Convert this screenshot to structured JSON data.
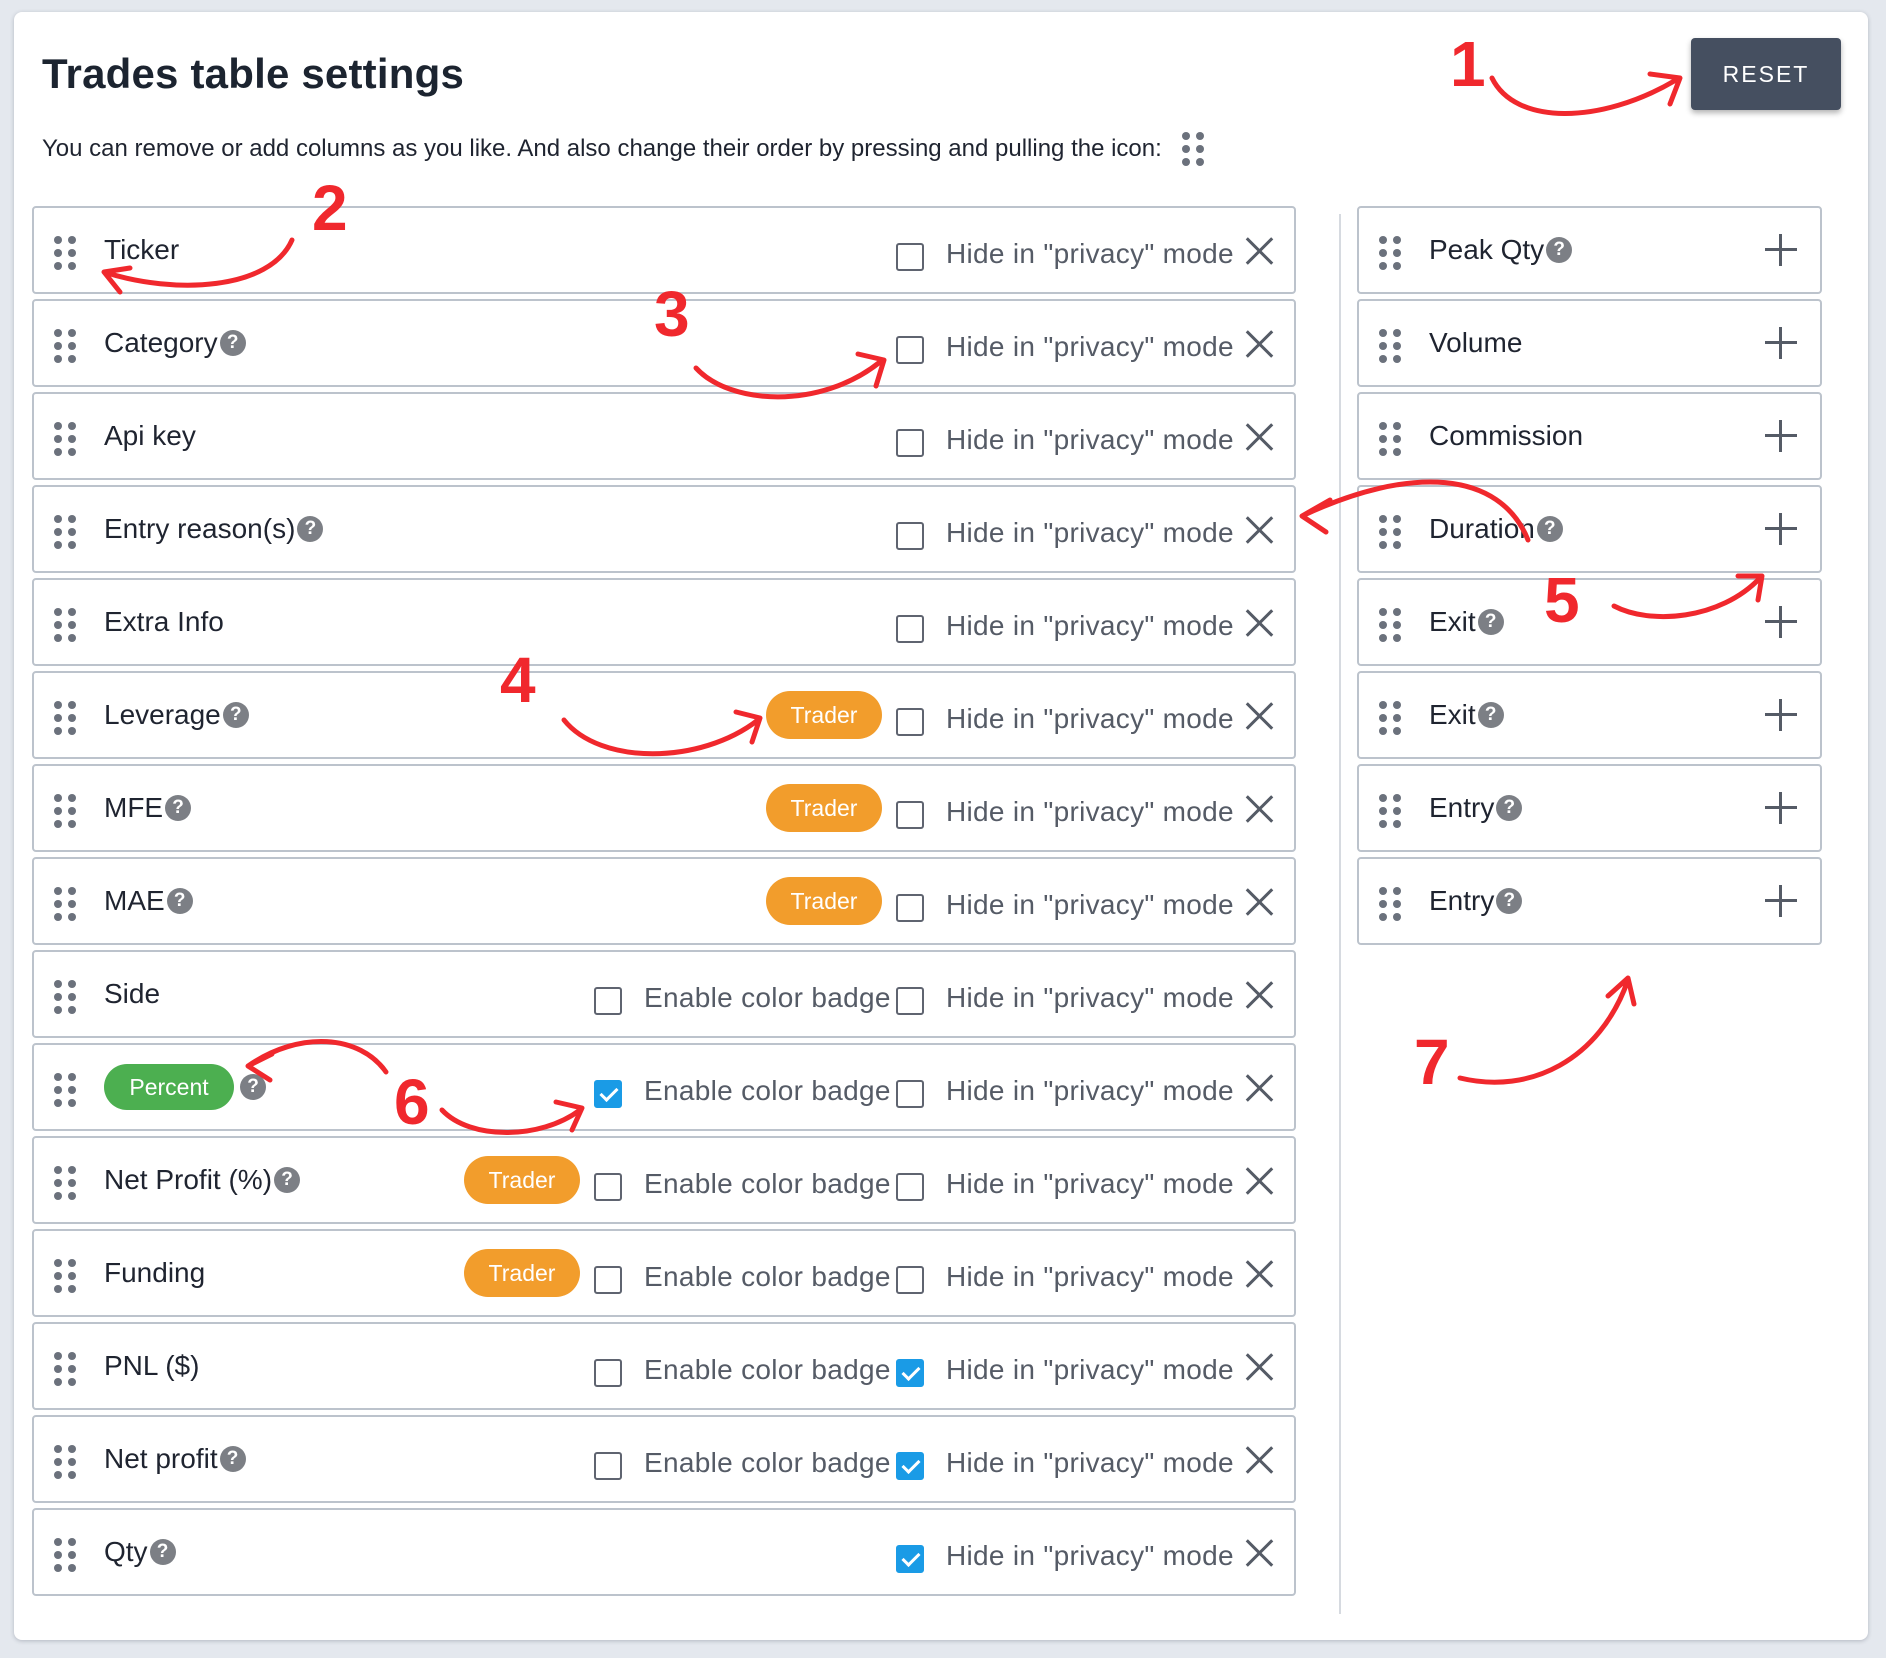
{
  "title": "Trades table settings",
  "subtitle": "You can remove or add columns as you like. And also change their order by pressing and pulling the icon:",
  "reset_label": "RESET",
  "privacy_label": "Hide in \"privacy\" mode",
  "color_badge_label": "Enable color badge",
  "trader_badge": "Trader",
  "help_glyph": "?",
  "colors": {
    "reset_button": "#454f60",
    "trader_badge": "#f29d2c",
    "percent_badge": "#4caf50",
    "checkbox_checked": "#1a9be6",
    "annotation": "#f0282d"
  },
  "active_columns": [
    {
      "label": "Ticker"
    },
    {
      "label": "Category",
      "help": true
    },
    {
      "label": "Api key"
    },
    {
      "label": "Entry reason(s)",
      "help": true
    },
    {
      "label": "Extra Info"
    },
    {
      "label": "Leverage",
      "help": true,
      "trader": true
    },
    {
      "label": "MFE",
      "help": true,
      "trader": true
    },
    {
      "label": "MAE",
      "help": true,
      "trader": true
    },
    {
      "label": "Side",
      "color_badge": false
    },
    {
      "label": "Percent",
      "help": true,
      "color_badge": true,
      "label_as_badge": true
    },
    {
      "label": "Net Profit (%)",
      "help": true,
      "trader": true,
      "color_badge": false
    },
    {
      "label": "Funding",
      "trader": true,
      "color_badge": false
    },
    {
      "label": "PNL ($)",
      "color_badge": false,
      "privacy": true
    },
    {
      "label": "Net profit",
      "help": true,
      "color_badge": false,
      "privacy": true
    },
    {
      "label": "Qty",
      "help": true,
      "privacy": true
    }
  ],
  "available_columns": [
    {
      "label": "Peak Qty",
      "help": true
    },
    {
      "label": "Volume"
    },
    {
      "label": "Commission"
    },
    {
      "label": "Duration",
      "help": true
    },
    {
      "label": "Exit",
      "help": true
    },
    {
      "label": "Exit",
      "help": true
    },
    {
      "label": "Entry",
      "help": true
    },
    {
      "label": "Entry",
      "help": true
    }
  ],
  "annotations": [
    "1",
    "2",
    "3",
    "4",
    "5",
    "6",
    "7"
  ]
}
